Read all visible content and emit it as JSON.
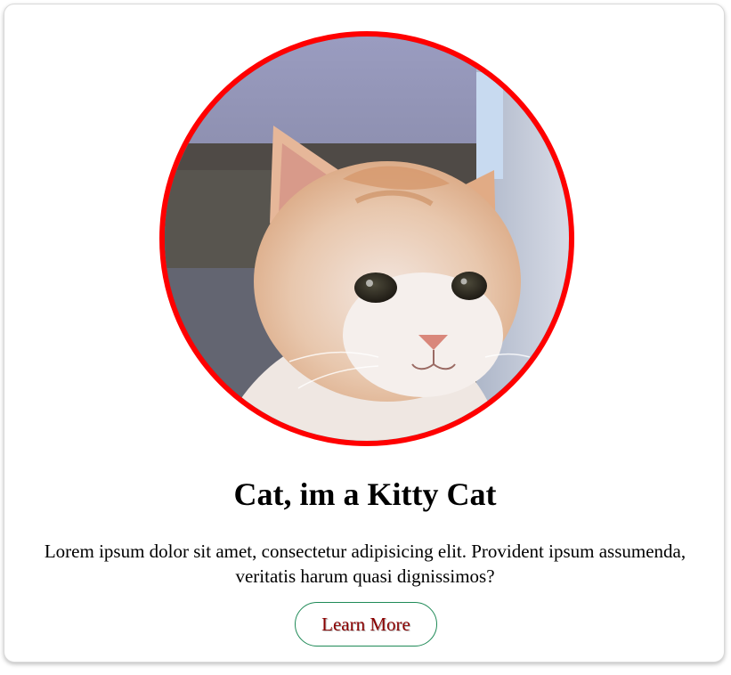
{
  "card": {
    "image_alt": "orange and white kitten",
    "title": "Cat, im a Kitty Cat",
    "body": "Lorem ipsum dolor sit amet, consectetur adipisicing elit. Provident ipsum assumenda, veritatis harum quasi dignissimos?",
    "button_label": "Learn More"
  },
  "colors": {
    "ring": "#ff0000",
    "button_border": "#1f8a57",
    "button_text": "#8b0000"
  }
}
